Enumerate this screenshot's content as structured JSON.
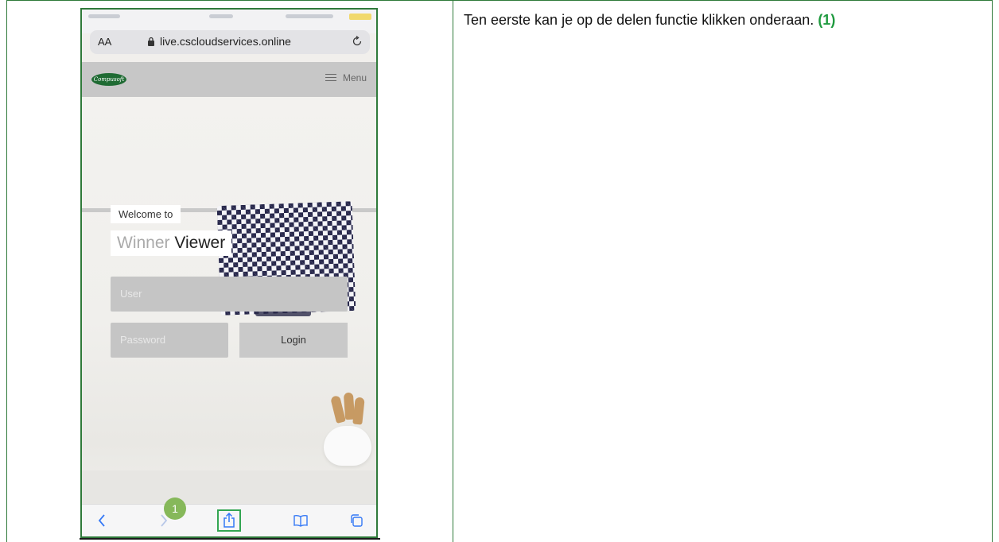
{
  "instruction": {
    "text": "Ten eerste kan je op de delen functie klikken onderaan.",
    "step_ref": "(1)"
  },
  "browser": {
    "text_size_label": "AA",
    "url": "live.cscloudservices.online",
    "icons": [
      "lock-icon",
      "reload-icon"
    ]
  },
  "site": {
    "logo_text": "Compusoft",
    "menu_label": "Menu",
    "welcome": "Welcome to",
    "title_light": "Winner",
    "title_dark": "Viewer",
    "user_placeholder": "User",
    "password_placeholder": "Password",
    "login_label": "Login"
  },
  "toolbar": {
    "icons": [
      "back-icon",
      "forward-icon",
      "share-icon",
      "bookmarks-icon",
      "tabs-icon"
    ],
    "highlight_color": "#33a652"
  },
  "step_badge": "1",
  "colors": {
    "accent_green": "#1f9a3f",
    "border_green": "#2f7a3a",
    "badge_green": "#86b85a"
  }
}
